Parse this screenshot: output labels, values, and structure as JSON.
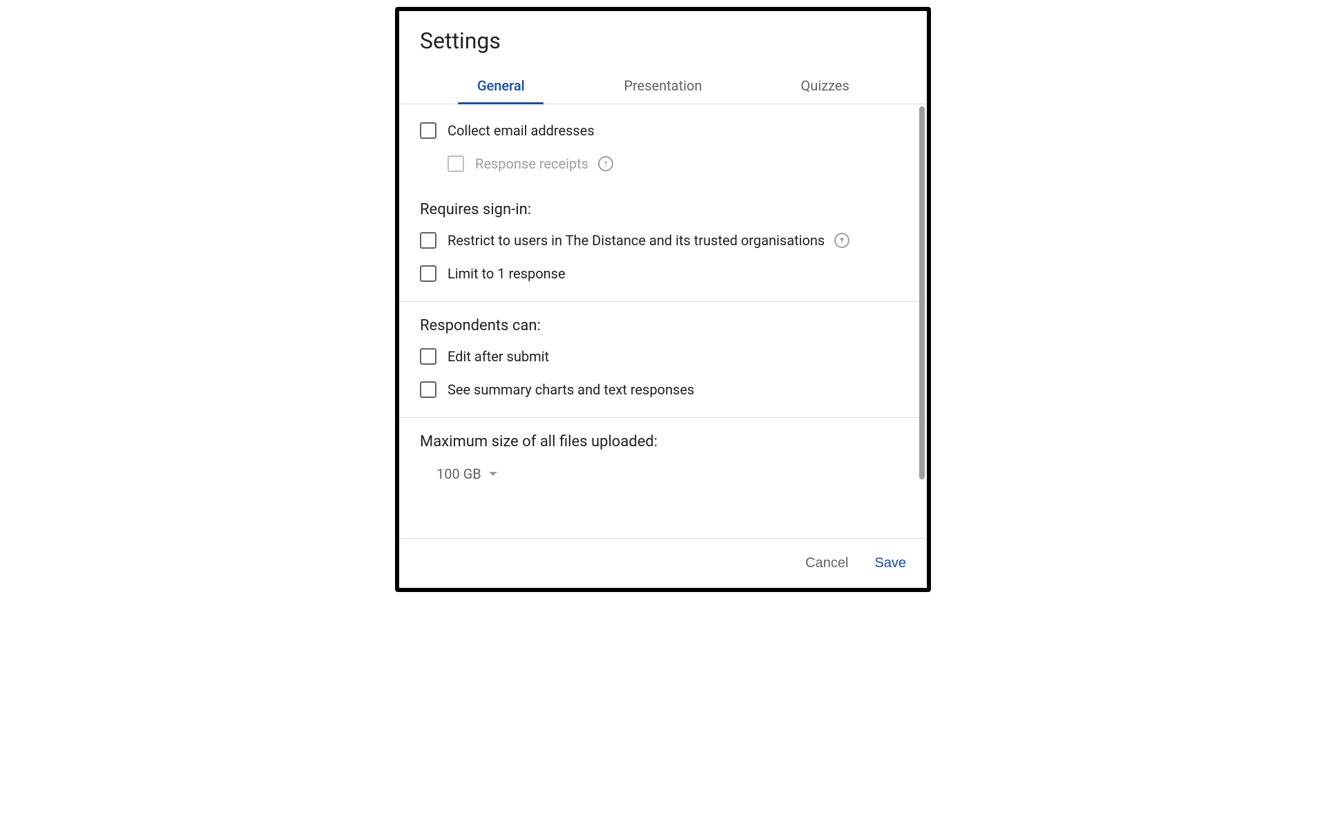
{
  "title": "Settings",
  "tabs": {
    "general": "General",
    "presentation": "Presentation",
    "quizzes": "Quizzes"
  },
  "options": {
    "collect_email": "Collect email addresses",
    "response_receipts": "Response receipts",
    "requires_signin_heading": "Requires sign-in:",
    "restrict_users": "Restrict to users in The Distance and its trusted organisations",
    "limit_response": "Limit to 1 response",
    "respondents_heading": "Respondents can:",
    "edit_after_submit": "Edit after submit",
    "see_summary": "See summary charts and text responses",
    "max_size_heading": "Maximum size of all files uploaded:",
    "max_size_value": "100 GB"
  },
  "footer": {
    "cancel": "Cancel",
    "save": "Save"
  }
}
